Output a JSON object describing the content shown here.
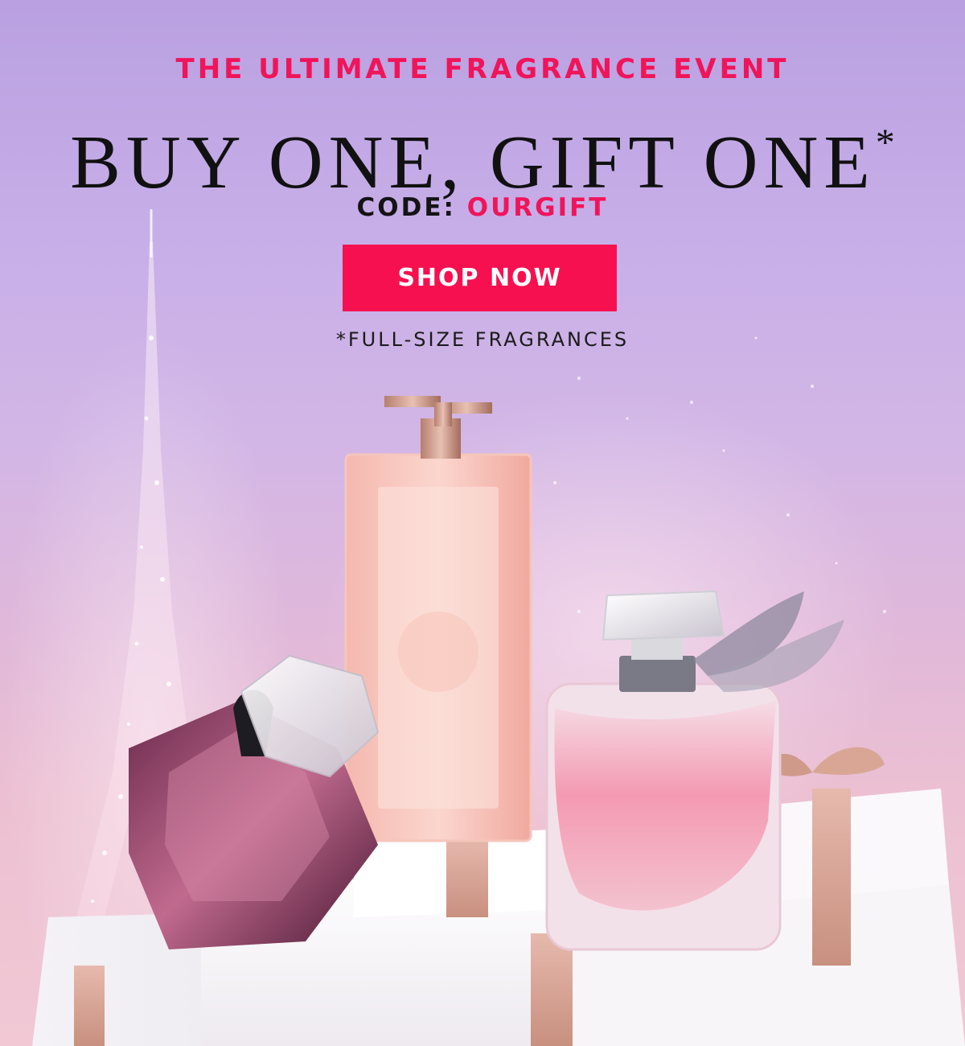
{
  "promo": {
    "eyebrow": "THE ULTIMATE FRAGRANCE EVENT",
    "headline": "BUY ONE, GIFT ONE",
    "headline_mark": "*",
    "code_label": "CODE:",
    "code_value": "OURGIFT",
    "cta_label": "SHOP NOW",
    "fineprint": "*FULL-SIZE FRAGRANCES"
  },
  "colors": {
    "accent": "#f0145a",
    "cta_background": "#f7104f",
    "headline": "#111111"
  },
  "imagery": {
    "background": "eiffel-tower-sparkle",
    "products": [
      "dark-diamond-perfume-bottle",
      "tall-rectangular-perfume-bottle",
      "round-pink-perfume-bottle-with-bow"
    ],
    "props": [
      "white-gift-boxes-with-rose-gold-ribbon"
    ]
  }
}
